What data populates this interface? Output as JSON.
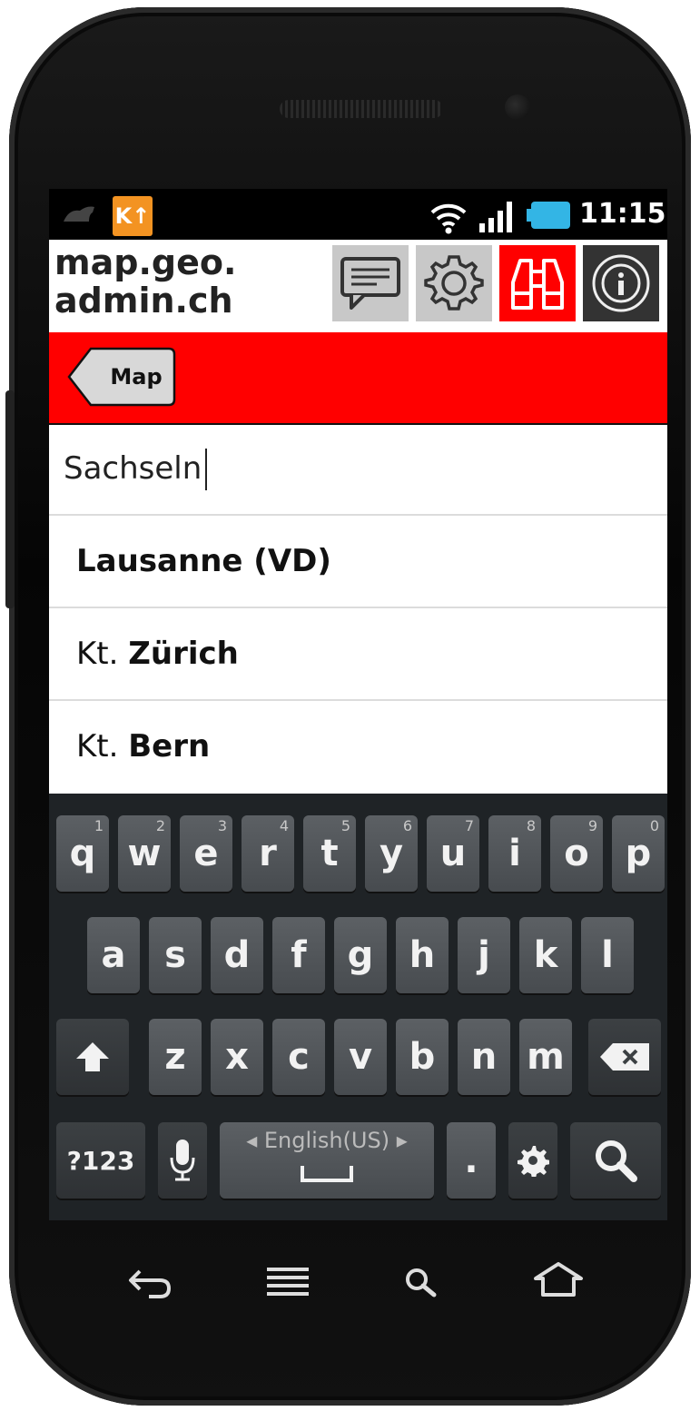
{
  "status_bar": {
    "time": "11:15",
    "notification_badge": "K↑"
  },
  "header": {
    "brand_line1": "map.geo.",
    "brand_line2": "admin.ch"
  },
  "toolbar": {
    "back_label": "Map"
  },
  "search": {
    "value": "Sachseln"
  },
  "results": [
    {
      "prefix": "",
      "bold": "Lausanne (VD)"
    },
    {
      "prefix": "Kt. ",
      "bold": "Zürich"
    },
    {
      "prefix": "Kt. ",
      "bold": "Bern"
    }
  ],
  "keyboard": {
    "row1": [
      {
        "ch": "q",
        "num": "1"
      },
      {
        "ch": "w",
        "num": "2"
      },
      {
        "ch": "e",
        "num": "3"
      },
      {
        "ch": "r",
        "num": "4"
      },
      {
        "ch": "t",
        "num": "5"
      },
      {
        "ch": "y",
        "num": "6"
      },
      {
        "ch": "u",
        "num": "7"
      },
      {
        "ch": "i",
        "num": "8"
      },
      {
        "ch": "o",
        "num": "9"
      },
      {
        "ch": "p",
        "num": "0"
      }
    ],
    "row2": [
      "a",
      "s",
      "d",
      "f",
      "g",
      "h",
      "j",
      "k",
      "l"
    ],
    "row3": [
      "z",
      "x",
      "c",
      "v",
      "b",
      "n",
      "m"
    ],
    "symbols_label": "?123",
    "language_label": "◂ English(US) ▸",
    "period_label": "."
  },
  "colors": {
    "accent": "#ff0000",
    "status_bg": "#000000",
    "keyboard_bg": "#1f2326"
  }
}
